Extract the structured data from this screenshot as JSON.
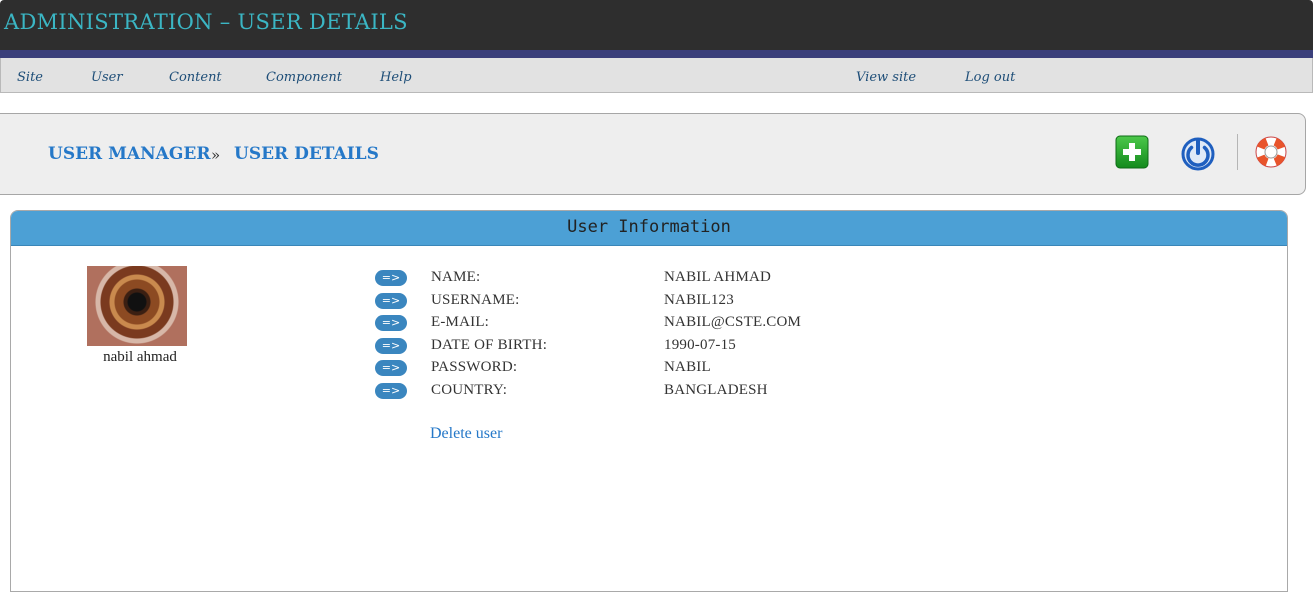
{
  "header": {
    "title": "Administration – User Details"
  },
  "menu": {
    "site": "Site",
    "user": "User",
    "content": "Content",
    "component": "Component",
    "help": "Help",
    "view_site": "View site",
    "log_out": "Log out"
  },
  "breadcrumb": {
    "parent": "User Manager",
    "separator": "»",
    "current": "User Details"
  },
  "toolbar": {
    "icons": [
      "add-icon",
      "power-icon",
      "help-lifebuoy-icon"
    ]
  },
  "panel": {
    "title": "User Information"
  },
  "user": {
    "avatar_caption": "nabil ahmad",
    "arrow_glyph": "=>",
    "fields": [
      {
        "label": "Name:",
        "value": "Nabil Ahmad"
      },
      {
        "label": "Username:",
        "value": "nabil123"
      },
      {
        "label": "E-mail:",
        "value": "nabil@cste.com"
      },
      {
        "label": "Date of birth:",
        "value": "1990-07-15"
      },
      {
        "label": "Password:",
        "value": "nabil"
      },
      {
        "label": "Country:",
        "value": "Bangladesh"
      }
    ],
    "delete_label": "Delete user"
  },
  "colors": {
    "header_bg": "#2e2e2e",
    "header_title": "#3bb6c4",
    "accent_stripe": "#3a3f7a",
    "link_blue": "#2578c8",
    "panel_head": "#4ca0d5"
  }
}
